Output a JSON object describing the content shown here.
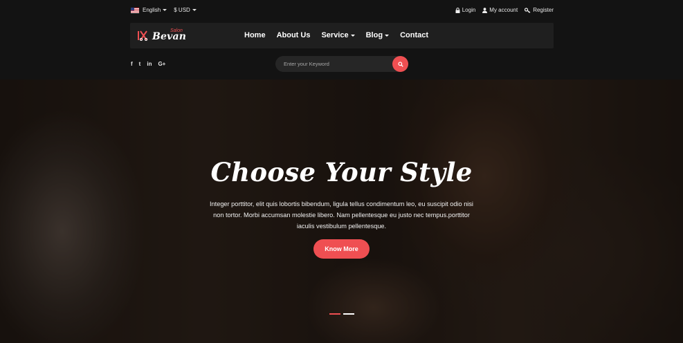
{
  "colors": {
    "accent": "#ef4f52",
    "header_bg": "#131313",
    "nav_bg": "#1f1f1f"
  },
  "topbar": {
    "language": "English",
    "currency": "$ USD",
    "login": "Login",
    "account": "My account",
    "register": "Register",
    "icons": {
      "flag": "us-flag-icon",
      "login": "lock-icon",
      "account": "user-icon",
      "register": "key-icon"
    }
  },
  "logo": {
    "brand": "Bevan",
    "sub": "Salon"
  },
  "menu": {
    "home": "Home",
    "about": "About Us",
    "service": "Service",
    "blog": "Blog",
    "contact": "Contact"
  },
  "social": {
    "facebook": "f",
    "twitter": "t",
    "linkedin": "in",
    "google": "G+"
  },
  "search": {
    "placeholder": "Enter your Keyword",
    "icon": "search-icon"
  },
  "hero": {
    "title": "Choose Your Style",
    "text": "Integer porttitor, elit quis lobortis bibendum, ligula tellus condimentum leo, eu suscipit odio nisi non tortor. Morbi accumsan molestie libero. Nam pellentesque eu justo nec tempus.porttitor iaculis vestibulum pellentesque.",
    "button": "Know More",
    "slides": {
      "count": 2,
      "active": 1
    }
  }
}
